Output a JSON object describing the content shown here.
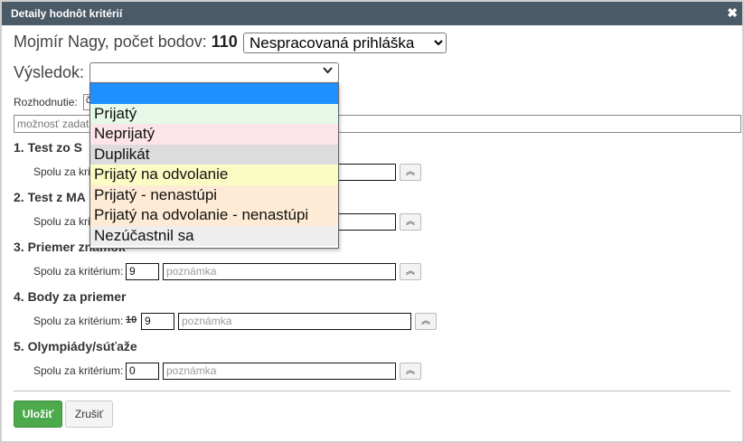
{
  "dialog": {
    "title": "Detaily hodnôt kritérií",
    "close_glyph": "✖"
  },
  "header": {
    "prefix": "Mojmír Nagy, počet bodov: ",
    "count": "110",
    "status_selected": "Nespracovaná prihláška"
  },
  "vysledok": {
    "label": "Výsledok:",
    "selected": "",
    "chevron": "⌄"
  },
  "dropdown": {
    "options": [
      {
        "label": "",
        "color": "#1e90ff"
      },
      {
        "label": "Prijatý",
        "color": "#e6f9e8"
      },
      {
        "label": "Neprijatý",
        "color": "#fde4e8"
      },
      {
        "label": "Duplikát",
        "color": "#dcdcdc"
      },
      {
        "label": "Prijatý na odvolanie",
        "color": "#fbfcc4"
      },
      {
        "label": "Prijatý - nenastúpi",
        "color": "#fdebd6"
      },
      {
        "label": "Prijatý na odvolanie - nenastúpi",
        "color": "#fdebd6"
      },
      {
        "label": "Nezúčastnil sa",
        "color": "#eeeeee"
      }
    ]
  },
  "rozhodnutie": {
    "label": "Rozhodnutie:",
    "value": "č"
  },
  "note": {
    "placeholder": "možnosť zadat"
  },
  "sections": [
    {
      "title": "1. Test zo S",
      "row_label": "Spolu za krit",
      "value": "",
      "poznamka": ""
    },
    {
      "title": "2. Test z MA",
      "row_label": "Spolu za krit",
      "value": "",
      "poznamka": ""
    },
    {
      "title": "3. Priemer známok",
      "row_label": "Spolu za kritérium:",
      "value": "9",
      "poznamka": "poznámka"
    },
    {
      "title": "4. Body za priemer",
      "row_label": "Spolu za kritérium:",
      "old_value": "10",
      "value": "9",
      "poznamka": "poznámka"
    },
    {
      "title": "5. Olympiády/súťaže",
      "row_label": "Spolu za kritérium:",
      "value": "0",
      "poznamka": "poznámka"
    }
  ],
  "expand_glyph": "⌃⌃",
  "buttons": {
    "save": "Uložiť",
    "cancel": "Zrušiť"
  }
}
